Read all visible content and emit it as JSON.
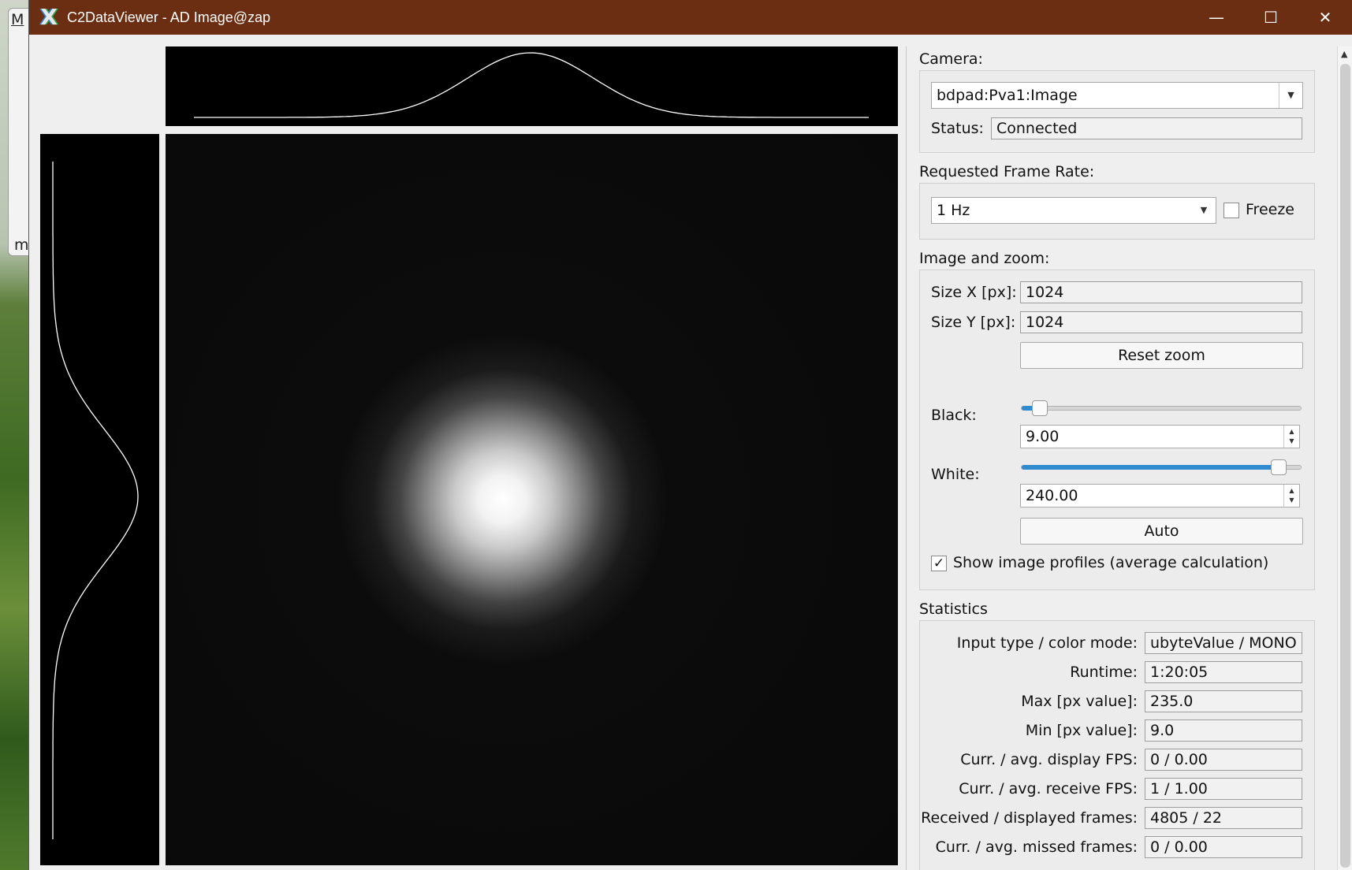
{
  "window": {
    "title": "C2DataViewer - AD Image@zap",
    "controls": {
      "minimize": "—",
      "maximize": "☐",
      "close": "✕"
    }
  },
  "background": {
    "menu_char": "M",
    "bottom_char": "m"
  },
  "camera": {
    "section_label": "Camera:",
    "selected": "bdpad:Pva1:Image",
    "status_label": "Status:",
    "status_value": "Connected"
  },
  "frame_rate": {
    "section_label": "Requested Frame Rate:",
    "selected": "1 Hz",
    "freeze_label": "Freeze",
    "freeze_checked": false
  },
  "image_zoom": {
    "section_label": "Image and zoom:",
    "size_x_label": "Size X [px]:",
    "size_x_value": "1024",
    "size_y_label": "Size Y [px]:",
    "size_y_value": "1024",
    "reset_zoom_label": "Reset zoom",
    "black_label": "Black:",
    "black_value": "9.00",
    "black_level": 0.04,
    "white_label": "White:",
    "white_value": "240.00",
    "white_level": 0.94,
    "auto_label": "Auto",
    "show_profiles_label": "Show image profiles (average calculation)",
    "show_profiles_checked": true
  },
  "statistics": {
    "section_label": "Statistics",
    "rows": [
      {
        "label": "Input type / color mode:",
        "value": "ubyteValue / MONO"
      },
      {
        "label": "Runtime:",
        "value": "1:20:05"
      },
      {
        "label": "Max [px value]:",
        "value": "235.0"
      },
      {
        "label": "Min [px value]:",
        "value": "9.0"
      },
      {
        "label": "Curr. / avg. display FPS:",
        "value": "0 / 0.00"
      },
      {
        "label": "Curr. / avg. receive FPS:",
        "value": "1 / 1.00"
      },
      {
        "label": "Received / displayed frames:",
        "value": "4805 / 22"
      },
      {
        "label": "Curr. / avg. missed frames:",
        "value": "0 / 0.00"
      }
    ]
  },
  "colors": {
    "titlebar": "#6b2e12",
    "slider_fill": "#2f8ad0",
    "profile_line": "#ffffff",
    "plot_background": "#000000"
  },
  "icons": {
    "app": "x-logo-icon",
    "dropdown": "chevron-down-icon",
    "check": "checkmark-icon"
  }
}
